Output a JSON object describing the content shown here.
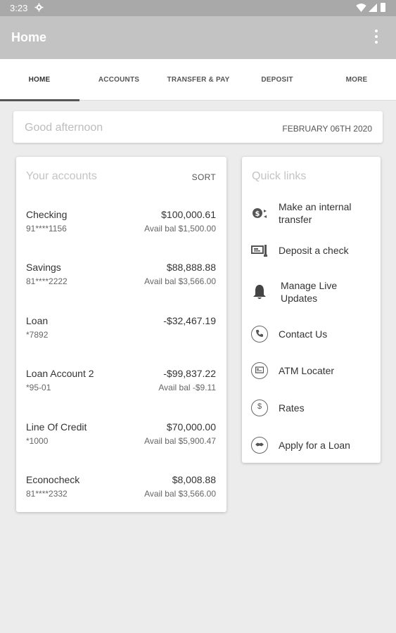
{
  "status_bar": {
    "time": "3:23"
  },
  "app_bar": {
    "title": "Home"
  },
  "tabs": [
    {
      "label": "HOME"
    },
    {
      "label": "ACCOUNTS"
    },
    {
      "label": "TRANSFER & PAY"
    },
    {
      "label": "DEPOSIT"
    },
    {
      "label": "MORE"
    }
  ],
  "greeting": {
    "text": "Good afternoon",
    "date": "FEBRUARY 06TH 2020"
  },
  "accounts": {
    "title": "Your accounts",
    "sort_label": "SORT",
    "items": [
      {
        "name": "Checking",
        "number": "91****1156",
        "amount": "$100,000.61",
        "avail": "Avail bal $1,500.00"
      },
      {
        "name": "Savings",
        "number": "81****2222",
        "amount": "$88,888.88",
        "avail": "Avail bal $3,566.00"
      },
      {
        "name": "Loan",
        "number": "*7892",
        "amount": "-$32,467.19",
        "avail": ""
      },
      {
        "name": "Loan Account 2",
        "number": "*95-01",
        "amount": "-$99,837.22",
        "avail": "Avail bal -$9.11"
      },
      {
        "name": "Line Of Credit",
        "number": "*1000",
        "amount": "$70,000.00",
        "avail": "Avail bal $5,900.47"
      },
      {
        "name": "Econocheck",
        "number": "81****2332",
        "amount": "$8,008.88",
        "avail": "Avail bal $3,566.00"
      }
    ]
  },
  "quick_links": {
    "title": "Quick links",
    "items": [
      {
        "label": "Make an internal transfer",
        "icon": "transfer-icon"
      },
      {
        "label": "Deposit a check",
        "icon": "check-icon"
      },
      {
        "label": "Manage Live Updates",
        "icon": "bell-icon"
      },
      {
        "label": "Contact Us",
        "icon": "phone-icon"
      },
      {
        "label": "ATM Locater",
        "icon": "atm-icon"
      },
      {
        "label": "Rates",
        "icon": "dollar-icon"
      },
      {
        "label": "Apply for a Loan",
        "icon": "handshake-icon"
      }
    ]
  }
}
